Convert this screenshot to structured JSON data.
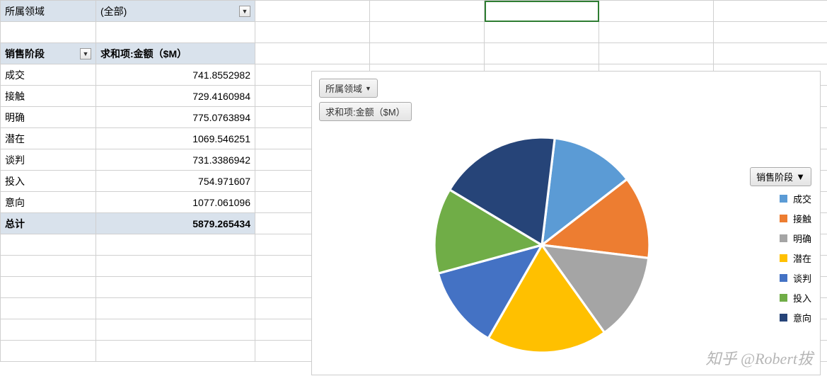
{
  "filter": {
    "label": "所属领域",
    "value": "(全部)"
  },
  "pivot": {
    "row_header": "销售阶段",
    "value_header": "求和项:金额（$M）",
    "rows": [
      {
        "label": "成交",
        "value": "741.8552982"
      },
      {
        "label": "接触",
        "value": "729.4160984"
      },
      {
        "label": "明确",
        "value": "775.0763894"
      },
      {
        "label": "潜在",
        "value": "1069.546251"
      },
      {
        "label": "谈判",
        "value": "731.3386942"
      },
      {
        "label": "投入",
        "value": "754.971607"
      },
      {
        "label": "意向",
        "value": "1077.061096"
      }
    ],
    "total_label": "总计",
    "total_value": "5879.265434"
  },
  "chart_controls": {
    "filter_field": "所属领域",
    "value_field": "求和项:金额（$M）",
    "legend_field": "销售阶段"
  },
  "chart_data": {
    "type": "pie",
    "title": "",
    "series": [
      {
        "name": "成交",
        "value": 741.8552982,
        "color": "#5b9bd5"
      },
      {
        "name": "接触",
        "value": 729.4160984,
        "color": "#ed7d31"
      },
      {
        "name": "明确",
        "value": 775.0763894,
        "color": "#a5a5a5"
      },
      {
        "name": "潜在",
        "value": 1069.546251,
        "color": "#ffc000"
      },
      {
        "name": "谈判",
        "value": 731.3386942,
        "color": "#4472c4"
      },
      {
        "name": "投入",
        "value": 754.971607,
        "color": "#70ad47"
      },
      {
        "name": "意向",
        "value": 1077.061096,
        "color": "#264478"
      }
    ]
  },
  "watermark": "知乎 @Robert拔"
}
